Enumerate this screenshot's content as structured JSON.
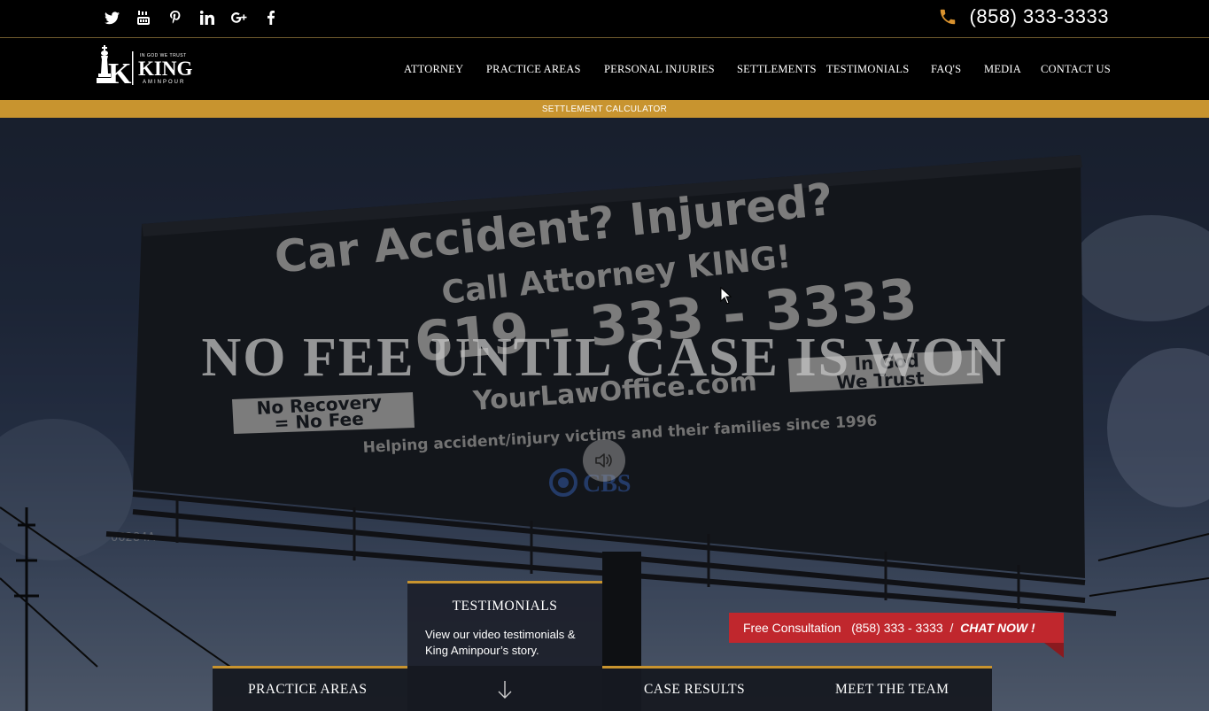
{
  "social": {
    "icons": [
      "twitter-icon",
      "youtube-icon",
      "pinterest-icon",
      "linkedin-icon",
      "google-plus-icon",
      "facebook-icon"
    ]
  },
  "header": {
    "phone": "(858) 333-3333",
    "logo": {
      "tagline": "IN GOD WE TRUST",
      "name": "KING",
      "sub": "AMINPOUR"
    }
  },
  "nav": {
    "items": [
      "ATTORNEY",
      "PRACTICE AREAS",
      "PERSONAL INJURIES",
      "SETTLEMENTS",
      "TESTIMONIALS",
      "FAQ'S",
      "MEDIA",
      "CONTACT US"
    ],
    "sub_bar": "SETTLEMENT CALCULATOR"
  },
  "hero": {
    "headline": "NO FEE UNTIL CASE IS WON",
    "billboard": {
      "line1": "Car Accident? Injured?",
      "line2": "Call Attorney KING!",
      "line3": "619 - 333 - 3333",
      "site": "YourLawOffice.com",
      "left_badge_1": "No Recovery",
      "left_badge_2": "= No Fee",
      "right_badge_1": "In God",
      "right_badge_2": "We Trust",
      "helping": "Helping accident/injury victims and their families since 1996",
      "cbs": "CBS",
      "id_tag": "06284A"
    }
  },
  "tabs": {
    "testimonials_title": "TESTIMONIALS",
    "testimonials_desc": "View our video testimonials & King Aminpour’s story.",
    "practice_areas": "PRACTICE AREAS",
    "case_results": "CASE RESULTS",
    "meet_team": "MEET THE TEAM"
  },
  "consult": {
    "label": "Free Consultation",
    "phone": "(858) 333 - 3333",
    "sep": "/",
    "chat": "CHAT NOW !"
  },
  "colors": {
    "gold": "#c8942f",
    "red": "#c0272d",
    "black": "#000000"
  }
}
